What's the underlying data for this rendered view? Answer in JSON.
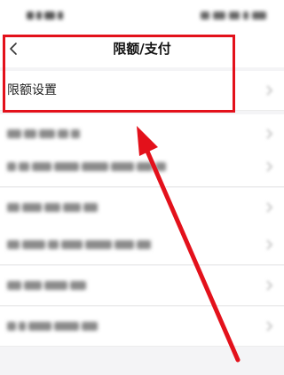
{
  "header": {
    "title": "限额/支付",
    "back_icon": "chevron-left-icon"
  },
  "rows": [
    {
      "label": "限额设置",
      "icon": "chevron-right-icon",
      "blurred": false
    },
    {
      "label": "",
      "icon": "chevron-right-icon",
      "blurred": true
    },
    {
      "label": "",
      "icon": "chevron-right-icon",
      "blurred": true
    },
    {
      "label": "",
      "icon": "chevron-right-icon",
      "blurred": true
    },
    {
      "label": "",
      "icon": "chevron-right-icon",
      "blurred": true
    },
    {
      "label": "",
      "icon": "chevron-right-icon",
      "blurred": true
    },
    {
      "label": "",
      "icon": "chevron-right-icon",
      "blurred": true
    }
  ],
  "annotations": {
    "highlight_color": "#e3111b",
    "arrow_color": "#e3111b"
  }
}
